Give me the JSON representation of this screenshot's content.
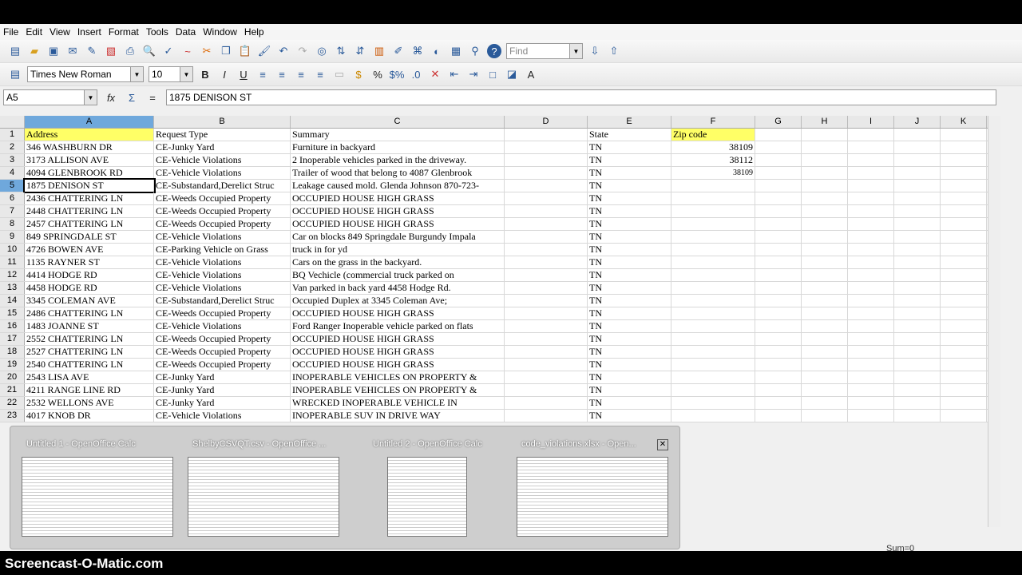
{
  "menu": [
    "File",
    "Edit",
    "View",
    "Insert",
    "Format",
    "Tools",
    "Data",
    "Window",
    "Help"
  ],
  "toolbar": {
    "find_placeholder": "Find",
    "font_name": "Times New Roman",
    "font_size": "10"
  },
  "formula": {
    "cell_ref": "A5",
    "content": "1875 DENISON ST"
  },
  "columns": [
    "A",
    "B",
    "C",
    "D",
    "E",
    "F",
    "G",
    "H",
    "I",
    "J",
    "K"
  ],
  "rows": [
    {
      "n": "1",
      "a": "Address",
      "b": "Request Type",
      "c": "Summary",
      "e": "State",
      "f": "Zip code"
    },
    {
      "n": "2",
      "a": "346 WASHBURN DR",
      "b": "CE-Junky Yard",
      "c": "Furniture in backyard",
      "e": "TN",
      "f": "38109"
    },
    {
      "n": "3",
      "a": "3173 ALLISON AVE",
      "b": "CE-Vehicle Violations",
      "c": "2 Inoperable vehicles parked in the driveway.",
      "e": "TN",
      "f": "38112"
    },
    {
      "n": "4",
      "a": "4094 GLENBROOK RD",
      "b": "CE-Vehicle Violations",
      "c": "Trailer of wood that belong to 4087 Glenbrook",
      "e": "TN",
      "f": "38109"
    },
    {
      "n": "5",
      "a": "1875 DENISON ST",
      "b": "CE-Substandard,Derelict Struc",
      "c": "Leakage caused mold.  Glenda Johnson 870-723-",
      "e": "TN",
      "f": ""
    },
    {
      "n": "6",
      "a": "2436 CHATTERING LN",
      "b": "CE-Weeds Occupied Property",
      "c": "OCCUPIED HOUSE HIGH GRASS",
      "e": "TN",
      "f": ""
    },
    {
      "n": "7",
      "a": "2448 CHATTERING LN",
      "b": "CE-Weeds Occupied Property",
      "c": "OCCUPIED HOUSE HIGH GRASS",
      "e": "TN",
      "f": ""
    },
    {
      "n": "8",
      "a": "2457 CHATTERING LN",
      "b": "CE-Weeds Occupied Property",
      "c": "OCCUPIED HOUSE HIGH GRASS",
      "e": "TN",
      "f": ""
    },
    {
      "n": "9",
      "a": "849 SPRINGDALE ST",
      "b": "CE-Vehicle Violations",
      "c": "Car on blocks 849 Springdale Burgundy Impala",
      "e": "TN",
      "f": ""
    },
    {
      "n": "10",
      "a": "4726 BOWEN AVE",
      "b": "CE-Parking Vehicle on Grass",
      "c": "truck in for yd",
      "e": "TN",
      "f": ""
    },
    {
      "n": "11",
      "a": "1135 RAYNER ST",
      "b": "CE-Vehicle Violations",
      "c": "Cars on the grass in the backyard.",
      "e": "TN",
      "f": ""
    },
    {
      "n": "12",
      "a": "4414 HODGE RD",
      "b": "CE-Vehicle Violations",
      "c": "BQ Vechicle (commercial truck parked on",
      "e": "TN",
      "f": ""
    },
    {
      "n": "13",
      "a": "4458 HODGE RD",
      "b": "CE-Vehicle Violations",
      "c": "Van parked in back yard 4458 Hodge Rd.",
      "e": "TN",
      "f": ""
    },
    {
      "n": "14",
      "a": "3345 COLEMAN AVE",
      "b": "CE-Substandard,Derelict Struc",
      "c": "Occupied Duplex at 3345 Coleman Ave;",
      "e": "TN",
      "f": ""
    },
    {
      "n": "15",
      "a": "2486 CHATTERING LN",
      "b": "CE-Weeds Occupied Property",
      "c": "OCCUPIED HOUSE HIGH GRASS",
      "e": "TN",
      "f": ""
    },
    {
      "n": "16",
      "a": "1483 JOANNE ST",
      "b": "CE-Vehicle Violations",
      "c": "Ford Ranger Inoperable vehicle parked on flats",
      "e": "TN",
      "f": ""
    },
    {
      "n": "17",
      "a": "2552 CHATTERING LN",
      "b": "CE-Weeds Occupied Property",
      "c": "OCCUPIED HOUSE HIGH GRASS",
      "e": "TN",
      "f": ""
    },
    {
      "n": "18",
      "a": "2527 CHATTERING LN",
      "b": "CE-Weeds Occupied Property",
      "c": "OCCUPIED HOUSE HIGH GRASS",
      "e": "TN",
      "f": ""
    },
    {
      "n": "19",
      "a": "2540 CHATTERING LN",
      "b": "CE-Weeds Occupied Property",
      "c": "OCCUPIED HOUSE HIGH GRASS",
      "e": "TN",
      "f": ""
    },
    {
      "n": "20",
      "a": "2543 LISA AVE",
      "b": "CE-Junky Yard",
      "c": "INOPERABLE VEHICLES ON PROPERTY &",
      "e": "TN",
      "f": ""
    },
    {
      "n": "21",
      "a": "4211 RANGE LINE RD",
      "b": "CE-Junky Yard",
      "c": "INOPERABLE VEHICLES ON PROPERTY &",
      "e": "TN",
      "f": ""
    },
    {
      "n": "22",
      "a": "2532 WELLONS AVE",
      "b": "CE-Junky Yard",
      "c": "WRECKED INOPERABLE VEHICLE IN",
      "e": "TN",
      "f": ""
    },
    {
      "n": "23",
      "a": "4017 KNOB DR",
      "b": "CE-Vehicle Violations",
      "c": "INOPERABLE SUV IN DRIVE WAY",
      "e": "TN",
      "f": ""
    }
  ],
  "taskbar_previews": [
    "Untitled 1 - OpenOffice Calc",
    "ShelbyCSVQT.csv - OpenOffice ...",
    "Untitled 2 - OpenOffice Calc",
    "code_violations.xlsx - Open..."
  ],
  "status": {
    "sum": "Sum=0"
  },
  "watermark": "Screencast-O-Matic.com"
}
